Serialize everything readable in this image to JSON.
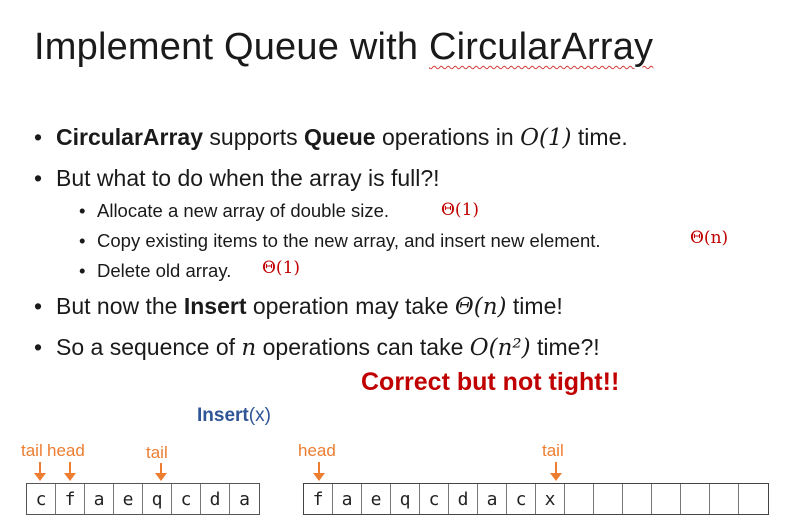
{
  "title": {
    "prefix": "Implement ",
    "queue": "Queue",
    "with": " with ",
    "circular": "CircularArray"
  },
  "bullets": {
    "b1": {
      "bold1": "CircularArray",
      "t1": " supports ",
      "bold2": "Queue",
      "t2": " operations in ",
      "math": "O(1)",
      "t3": " time."
    },
    "b2": {
      "text": "But what to do when the array is full?!"
    },
    "sub1": {
      "text": "Allocate a new array of double size.",
      "cost": "Θ(1)"
    },
    "sub2": {
      "text": "Copy existing items to the new array, and insert new element.",
      "cost": "Θ(n)"
    },
    "sub3": {
      "text": "Delete old array.",
      "cost": "Θ(1)"
    },
    "b3": {
      "t1": "But now the ",
      "bold": "Insert",
      "t2": " operation may take ",
      "math": "Θ(n)",
      "t3": " time!"
    },
    "b4": {
      "t1": "So a sequence of ",
      "math1": "n",
      "t2": " operations can take ",
      "math2": "O(n²)",
      "t3": " time?!"
    }
  },
  "correct_note": "Correct but not tight!!",
  "insert_label": {
    "op": "Insert",
    "arg": "(x)"
  },
  "left_array": {
    "labels": {
      "tail1": "tail",
      "head": "head",
      "tail2": "tail"
    },
    "cells": [
      "c",
      "f",
      "a",
      "e",
      "q",
      "c",
      "d",
      "a"
    ]
  },
  "right_array": {
    "labels": {
      "head": "head",
      "tail": "tail"
    },
    "cells": [
      "f",
      "a",
      "e",
      "q",
      "c",
      "d",
      "a",
      "c",
      "x",
      "",
      "",
      "",
      "",
      "",
      "",
      ""
    ]
  },
  "colors": {
    "accent_red": "#c00000",
    "orange": "#ed7d31",
    "blue": "#2f5597"
  }
}
